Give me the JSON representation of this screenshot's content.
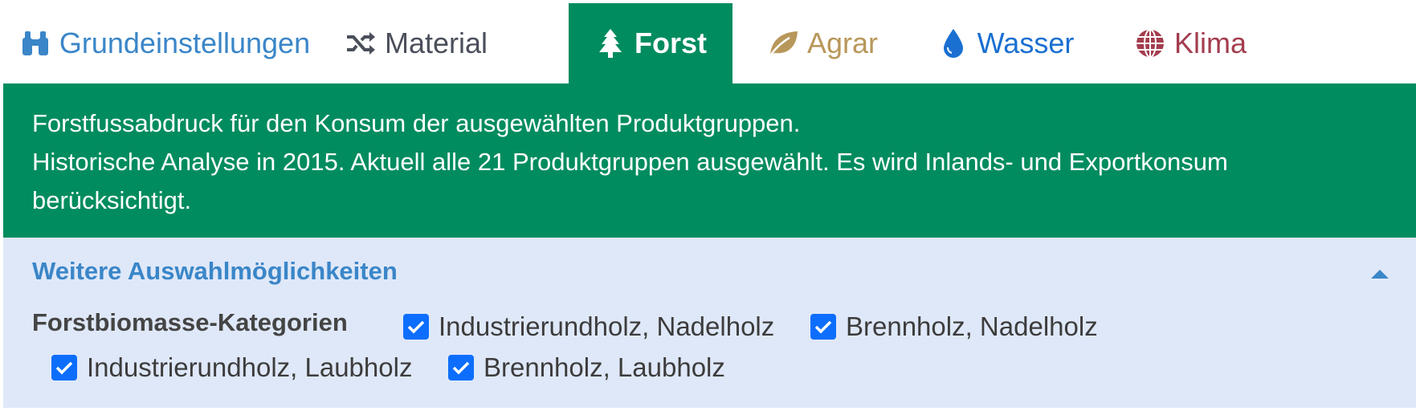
{
  "colors": {
    "forest_green": "#008c5f",
    "options_bg": "#dfe8f8",
    "link_blue": "#3a86c8",
    "material_gray": "#4a4f5a",
    "agrar_gold": "#b8975a",
    "wasser_blue": "#1a6fd1",
    "klima_red": "#a33d4f",
    "checkbox_blue": "#0d6efd"
  },
  "tabs": [
    {
      "id": "grundeinstellungen",
      "label": "Grundeinstellungen",
      "icon": "binoculars-icon",
      "active": false
    },
    {
      "id": "material",
      "label": "Material",
      "icon": "shuffle-icon",
      "active": false
    },
    {
      "id": "forst",
      "label": "Forst",
      "icon": "tree-icon",
      "active": true
    },
    {
      "id": "agrar",
      "label": "Agrar",
      "icon": "leaf-icon",
      "active": false
    },
    {
      "id": "wasser",
      "label": "Wasser",
      "icon": "water-drop-icon",
      "active": false
    },
    {
      "id": "klima",
      "label": "Klima",
      "icon": "globe-icon",
      "active": false
    }
  ],
  "description": {
    "line1": "Forstfussabdruck für den Konsum der ausgewählten Produktgruppen.",
    "line2": "Historische Analyse in 2015. Aktuell alle 21 Produktgruppen ausgewählt. Es wird Inlands- und Exportkonsum berücksichtigt."
  },
  "options": {
    "title": "Weitere Auswahlmöglichkeiten",
    "toggle_icon": "caret-up-icon",
    "category_label": "Forstbiomasse-Kategorien",
    "checkboxes": [
      {
        "label": "Industrierundholz, Nadelholz",
        "checked": true
      },
      {
        "label": "Brennholz, Nadelholz",
        "checked": true
      },
      {
        "label": "Industrierundholz, Laubholz",
        "checked": true
      },
      {
        "label": "Brennholz, Laubholz",
        "checked": true
      }
    ]
  }
}
